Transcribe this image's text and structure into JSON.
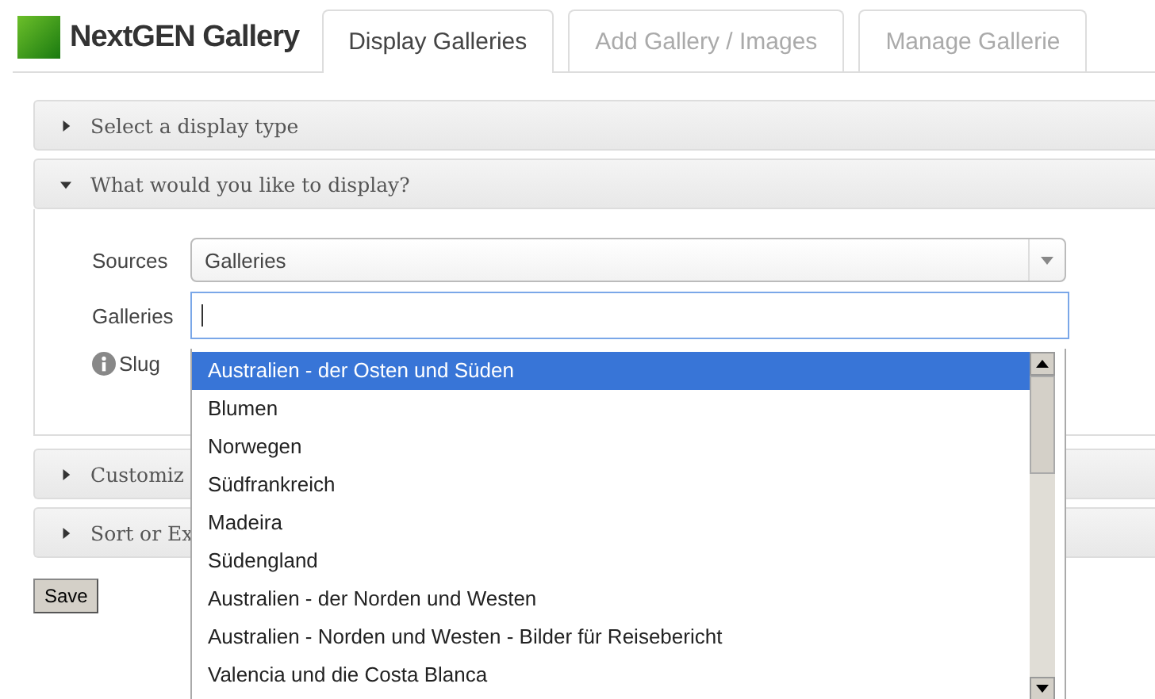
{
  "header": {
    "logo": "NextGEN Gallery"
  },
  "tabs": [
    {
      "label": "Display Galleries",
      "selected": true
    },
    {
      "label": "Add Gallery / Images",
      "selected": false
    },
    {
      "label": "Manage Gallerie",
      "selected": false
    }
  ],
  "sections": [
    {
      "title": "Select a display type",
      "expanded": false
    },
    {
      "title": "What would you like to display?",
      "expanded": true
    },
    {
      "title": "Customiz",
      "expanded": false
    },
    {
      "title": "Sort or Ex",
      "expanded": false
    }
  ],
  "form": {
    "sources_label": "Sources",
    "sources_value": "Galleries",
    "galleries_label": "Galleries",
    "slug_label": "Slug"
  },
  "dropdown": {
    "items": [
      {
        "label": "Australien - der Osten und Süden",
        "selected": true
      },
      {
        "label": "Blumen",
        "selected": false
      },
      {
        "label": "Norwegen",
        "selected": false
      },
      {
        "label": "Südfrankreich",
        "selected": false
      },
      {
        "label": "Madeira",
        "selected": false
      },
      {
        "label": "Südengland",
        "selected": false
      },
      {
        "label": "Australien - der Norden und Westen",
        "selected": false
      },
      {
        "label": "Australien - Norden und Westen - Bilder für Reisebericht",
        "selected": false
      },
      {
        "label": "Valencia und die Costa Blanca",
        "selected": false
      }
    ]
  },
  "save_button": "Save"
}
